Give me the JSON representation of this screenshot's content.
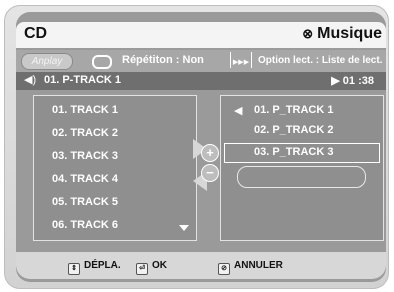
{
  "header": {
    "title": "CD",
    "mode_icon": "circle-x-icon",
    "mode_label": "Musique",
    "mode_icon_glyph": "⊗"
  },
  "toolbar": {
    "play_mode_label": "Anplay",
    "repeat_icon": "repeat-icon",
    "repeat_label": "Répétiton : Non",
    "option_icon": "list-option-icon",
    "option_label": "Option lect. : Liste de lect."
  },
  "now_playing": {
    "track": "01. P-TRACK 1",
    "time": "▶ 01 :38",
    "speaker_glyph": "◀)"
  },
  "left_list": {
    "items": [
      "01. TRACK 1",
      "02. TRACK 2",
      "03. TRACK 3",
      "04. TRACK 4",
      "05. TRACK 5",
      "06. TRACK 6"
    ]
  },
  "right_list": {
    "speaker_glyph": "◀",
    "items": [
      "01. P_TRACK 1",
      "02. P_TRACK 2",
      "03. P_TRACK 3"
    ],
    "selected_index": 2
  },
  "buttons": {
    "add_glyph": "+",
    "remove_glyph": "−"
  },
  "footer": {
    "move_label": "DÉPLA.",
    "ok_label": "OK",
    "cancel_label": "ANNULER",
    "move_glyph": "⇕",
    "ok_glyph": "⏎",
    "cancel_glyph": "⊘"
  }
}
